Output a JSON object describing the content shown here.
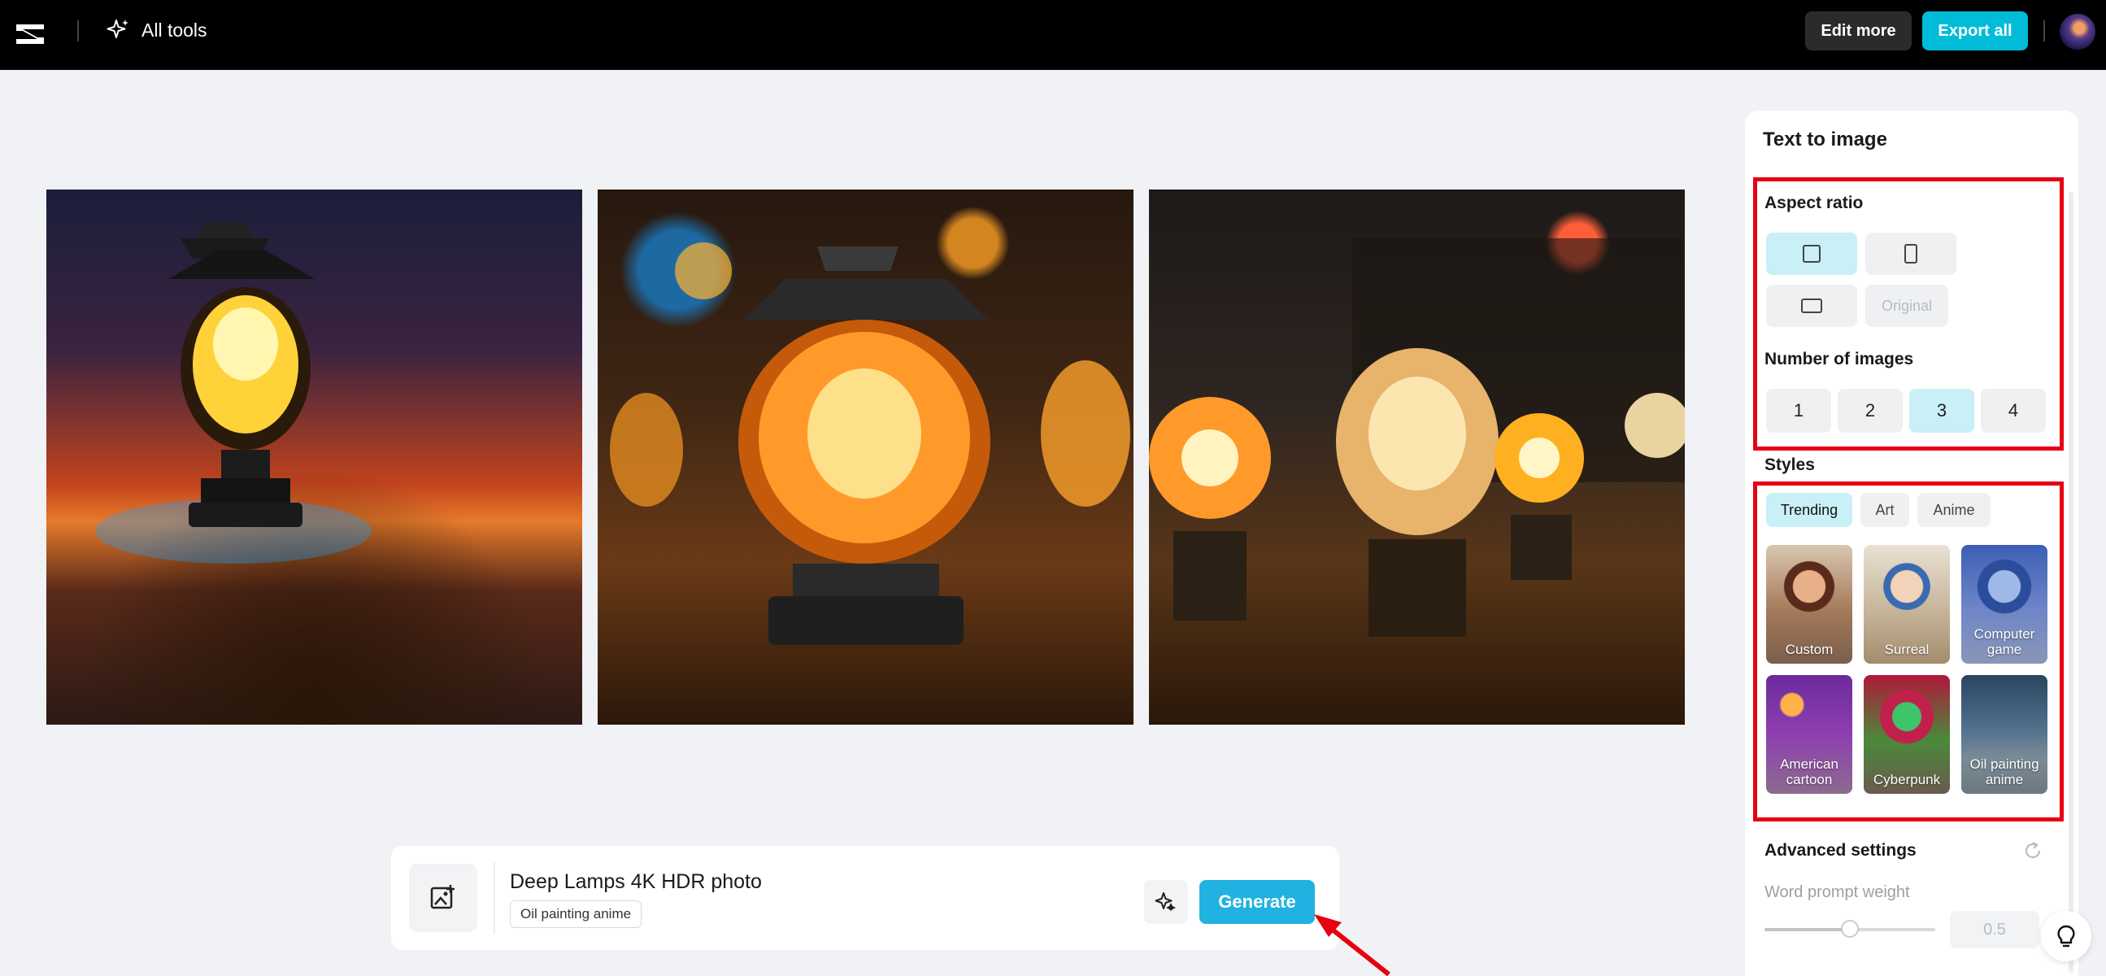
{
  "topbar": {
    "logo_icon": "capcut-logo",
    "all_tools_label": "All tools",
    "edit_more_label": "Edit more",
    "export_all_label": "Export all"
  },
  "gallery": [
    {
      "name": "generated-image-1"
    },
    {
      "name": "generated-image-2"
    },
    {
      "name": "generated-image-3"
    }
  ],
  "prompt": {
    "text": "Deep Lamps 4K HDR photo",
    "style_tag": "Oil painting anime",
    "generate_label": "Generate"
  },
  "panel": {
    "title": "Text to image",
    "aspect_ratio": {
      "label": "Aspect ratio",
      "options": [
        {
          "id": "square",
          "selected": true
        },
        {
          "id": "portrait",
          "selected": false
        },
        {
          "id": "landscape",
          "selected": false
        },
        {
          "id": "original",
          "label": "Original",
          "disabled": true
        }
      ]
    },
    "num_images": {
      "label": "Number of images",
      "options": [
        "1",
        "2",
        "3",
        "4"
      ],
      "selected": "3"
    },
    "styles": {
      "label": "Styles",
      "tabs": [
        "Trending",
        "Art",
        "Anime"
      ],
      "active_tab": "Trending",
      "cards": [
        {
          "label": "Custom",
          "selected": false
        },
        {
          "label": "Surreal",
          "selected": false
        },
        {
          "label": "Computer game",
          "selected": false
        },
        {
          "label": "American cartoon",
          "selected": false
        },
        {
          "label": "Cyberpunk",
          "selected": false
        },
        {
          "label": "Oil painting anime",
          "selected": true
        }
      ]
    },
    "advanced": {
      "label": "Advanced settings",
      "word_prompt_weight_label": "Word prompt weight",
      "word_prompt_weight_value": "0.5",
      "slider_fraction": 0.5
    }
  },
  "colors": {
    "accent": "#00bcd9",
    "generate": "#20b2e0",
    "selected_option": "#c8f0f6",
    "annotation_red": "#e60012"
  }
}
